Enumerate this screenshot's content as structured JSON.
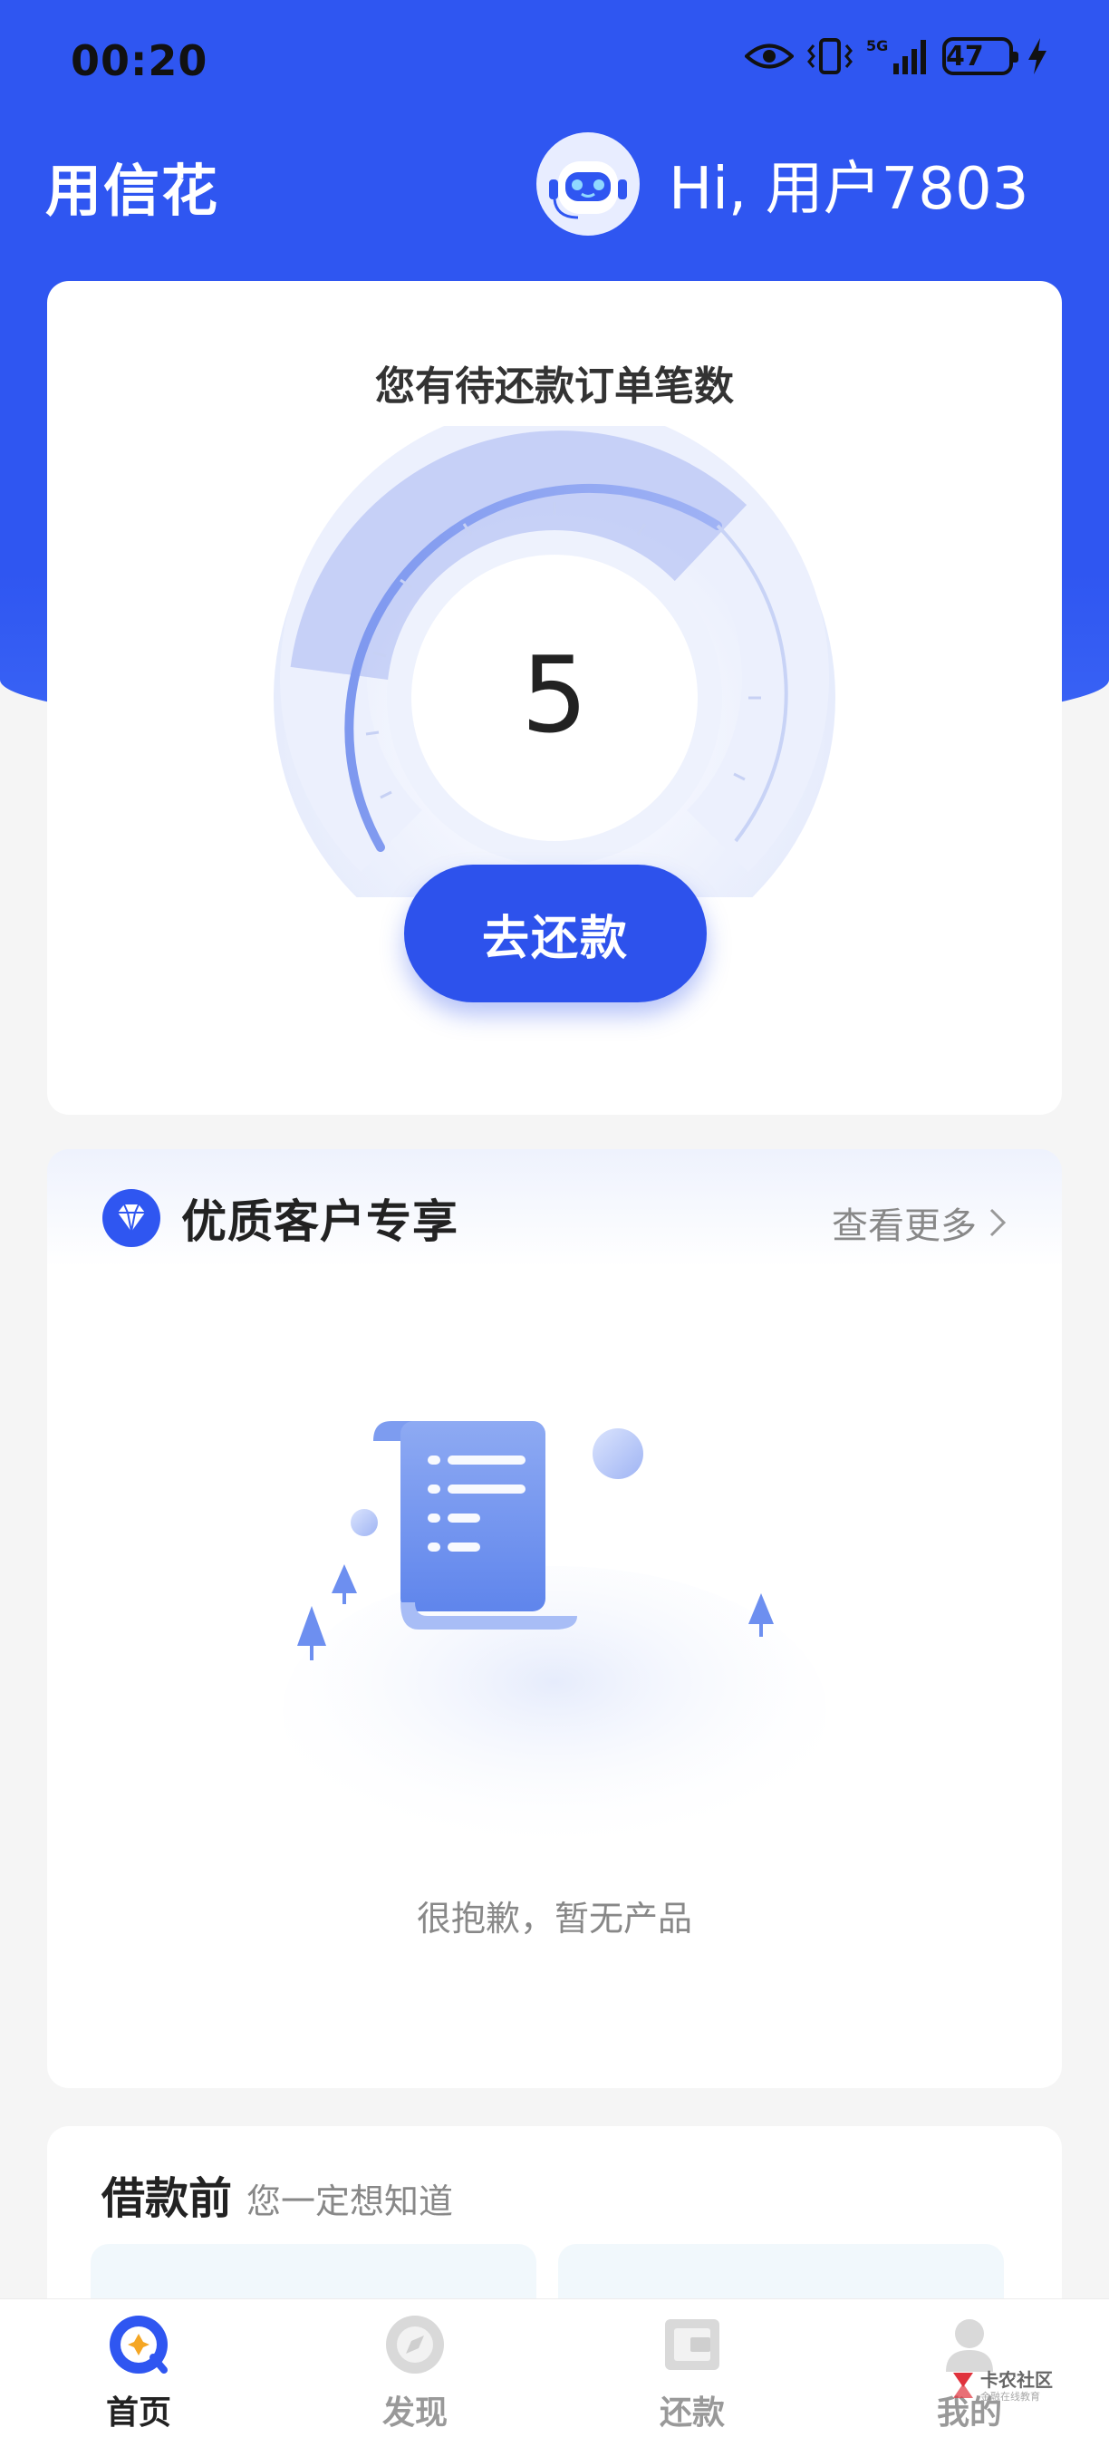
{
  "status_bar": {
    "time": "00:20",
    "battery": "47",
    "network": "5G"
  },
  "header": {
    "app_title": "用信花",
    "greeting": "Hi, 用户7803"
  },
  "repay_card": {
    "title": "您有待还款订单笔数",
    "count": "5",
    "button_label": "去还款"
  },
  "premium": {
    "title": "优质客户专享",
    "see_more": "查看更多",
    "empty_text": "很抱歉，暂无产品"
  },
  "before_loan": {
    "title": "借款前",
    "subtitle": "您一定想知道"
  },
  "nav": {
    "items": [
      {
        "label": "首页",
        "icon": "home-icon",
        "active": true
      },
      {
        "label": "发现",
        "icon": "discover-icon",
        "active": false
      },
      {
        "label": "还款",
        "icon": "repay-icon",
        "active": false
      },
      {
        "label": "我的",
        "icon": "profile-icon",
        "active": false
      }
    ]
  },
  "watermark": {
    "text": "卡农社区",
    "sub": "金融在线教育"
  },
  "colors": {
    "brand_blue": "#2f56f1",
    "button_blue": "#2d52ec",
    "light_blue": "#dfe6fc"
  }
}
